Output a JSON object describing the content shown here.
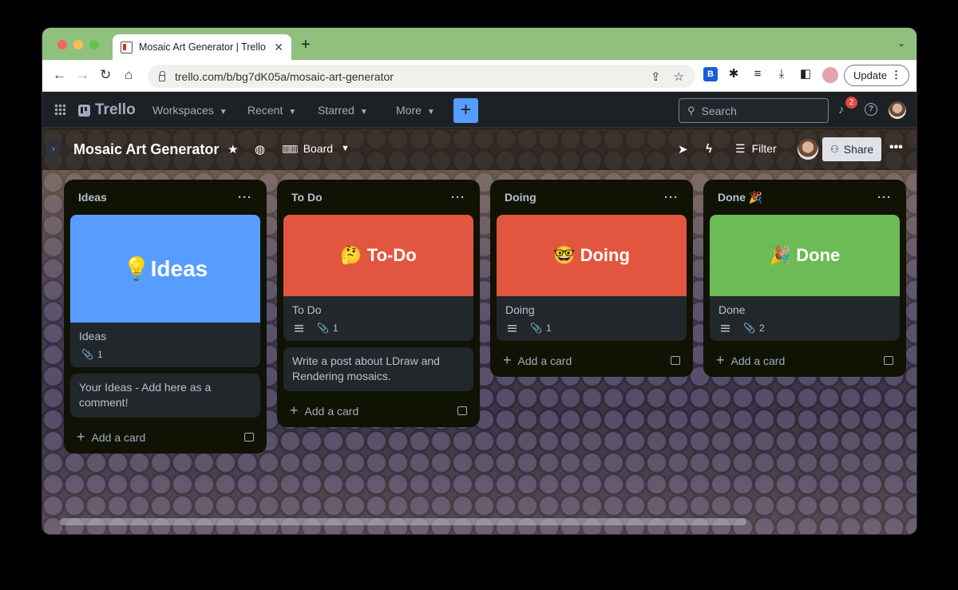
{
  "browser": {
    "tab_title": "Mosaic Art Generator | Trello",
    "tab_close": "✕",
    "new_tab": "+",
    "url": "trello.com/b/bg7dK05a/mosaic-art-generator",
    "update_label": "Update",
    "update_menu": "⋮"
  },
  "header": {
    "logo_text": "Trello",
    "nav": [
      "Workspaces",
      "Recent",
      "Starred",
      "More"
    ],
    "create_label": "+",
    "search_placeholder": "Search",
    "notification_count": "2",
    "help": "?"
  },
  "board": {
    "title": "Mosaic Art Generator",
    "view_label": "Board",
    "filter_label": "Filter",
    "share_label": "Share",
    "more": "•••"
  },
  "lists": [
    {
      "title": "Ideas",
      "cards": [
        {
          "cover_text": "💡Ideas",
          "cover_color": "#579dff",
          "title": "Ideas",
          "attachments": "1",
          "has_description": false
        },
        {
          "title": "Your Ideas - Add here as a comment!"
        }
      ],
      "add_label": "Add a card"
    },
    {
      "title": "To Do",
      "cards": [
        {
          "cover_text": "🤔 To-Do",
          "cover_color": "#e2563f",
          "title": "To Do",
          "attachments": "1",
          "has_description": true
        },
        {
          "title": "Write a post about LDraw and Rendering mosaics."
        }
      ],
      "add_label": "Add a card"
    },
    {
      "title": "Doing",
      "cards": [
        {
          "cover_text": "🤓 Doing",
          "cover_color": "#e2563f",
          "title": "Doing",
          "attachments": "1",
          "has_description": true
        }
      ],
      "add_label": "Add a card"
    },
    {
      "title": "Done 🎉",
      "cards": [
        {
          "cover_text": "🎉 Done",
          "cover_color": "#6cbb55",
          "title": "Done",
          "attachments": "2",
          "has_description": true
        }
      ],
      "add_label": "Add a card"
    }
  ],
  "icons": {
    "paperclip": "📎",
    "star": "★",
    "globe": "◍",
    "rocket": "➤",
    "bolt": "ϟ"
  },
  "colors": {
    "accent": "#579dff",
    "list_bg": "#101204",
    "card_bg": "#22272b",
    "tab_bar": "#8fc07d"
  }
}
